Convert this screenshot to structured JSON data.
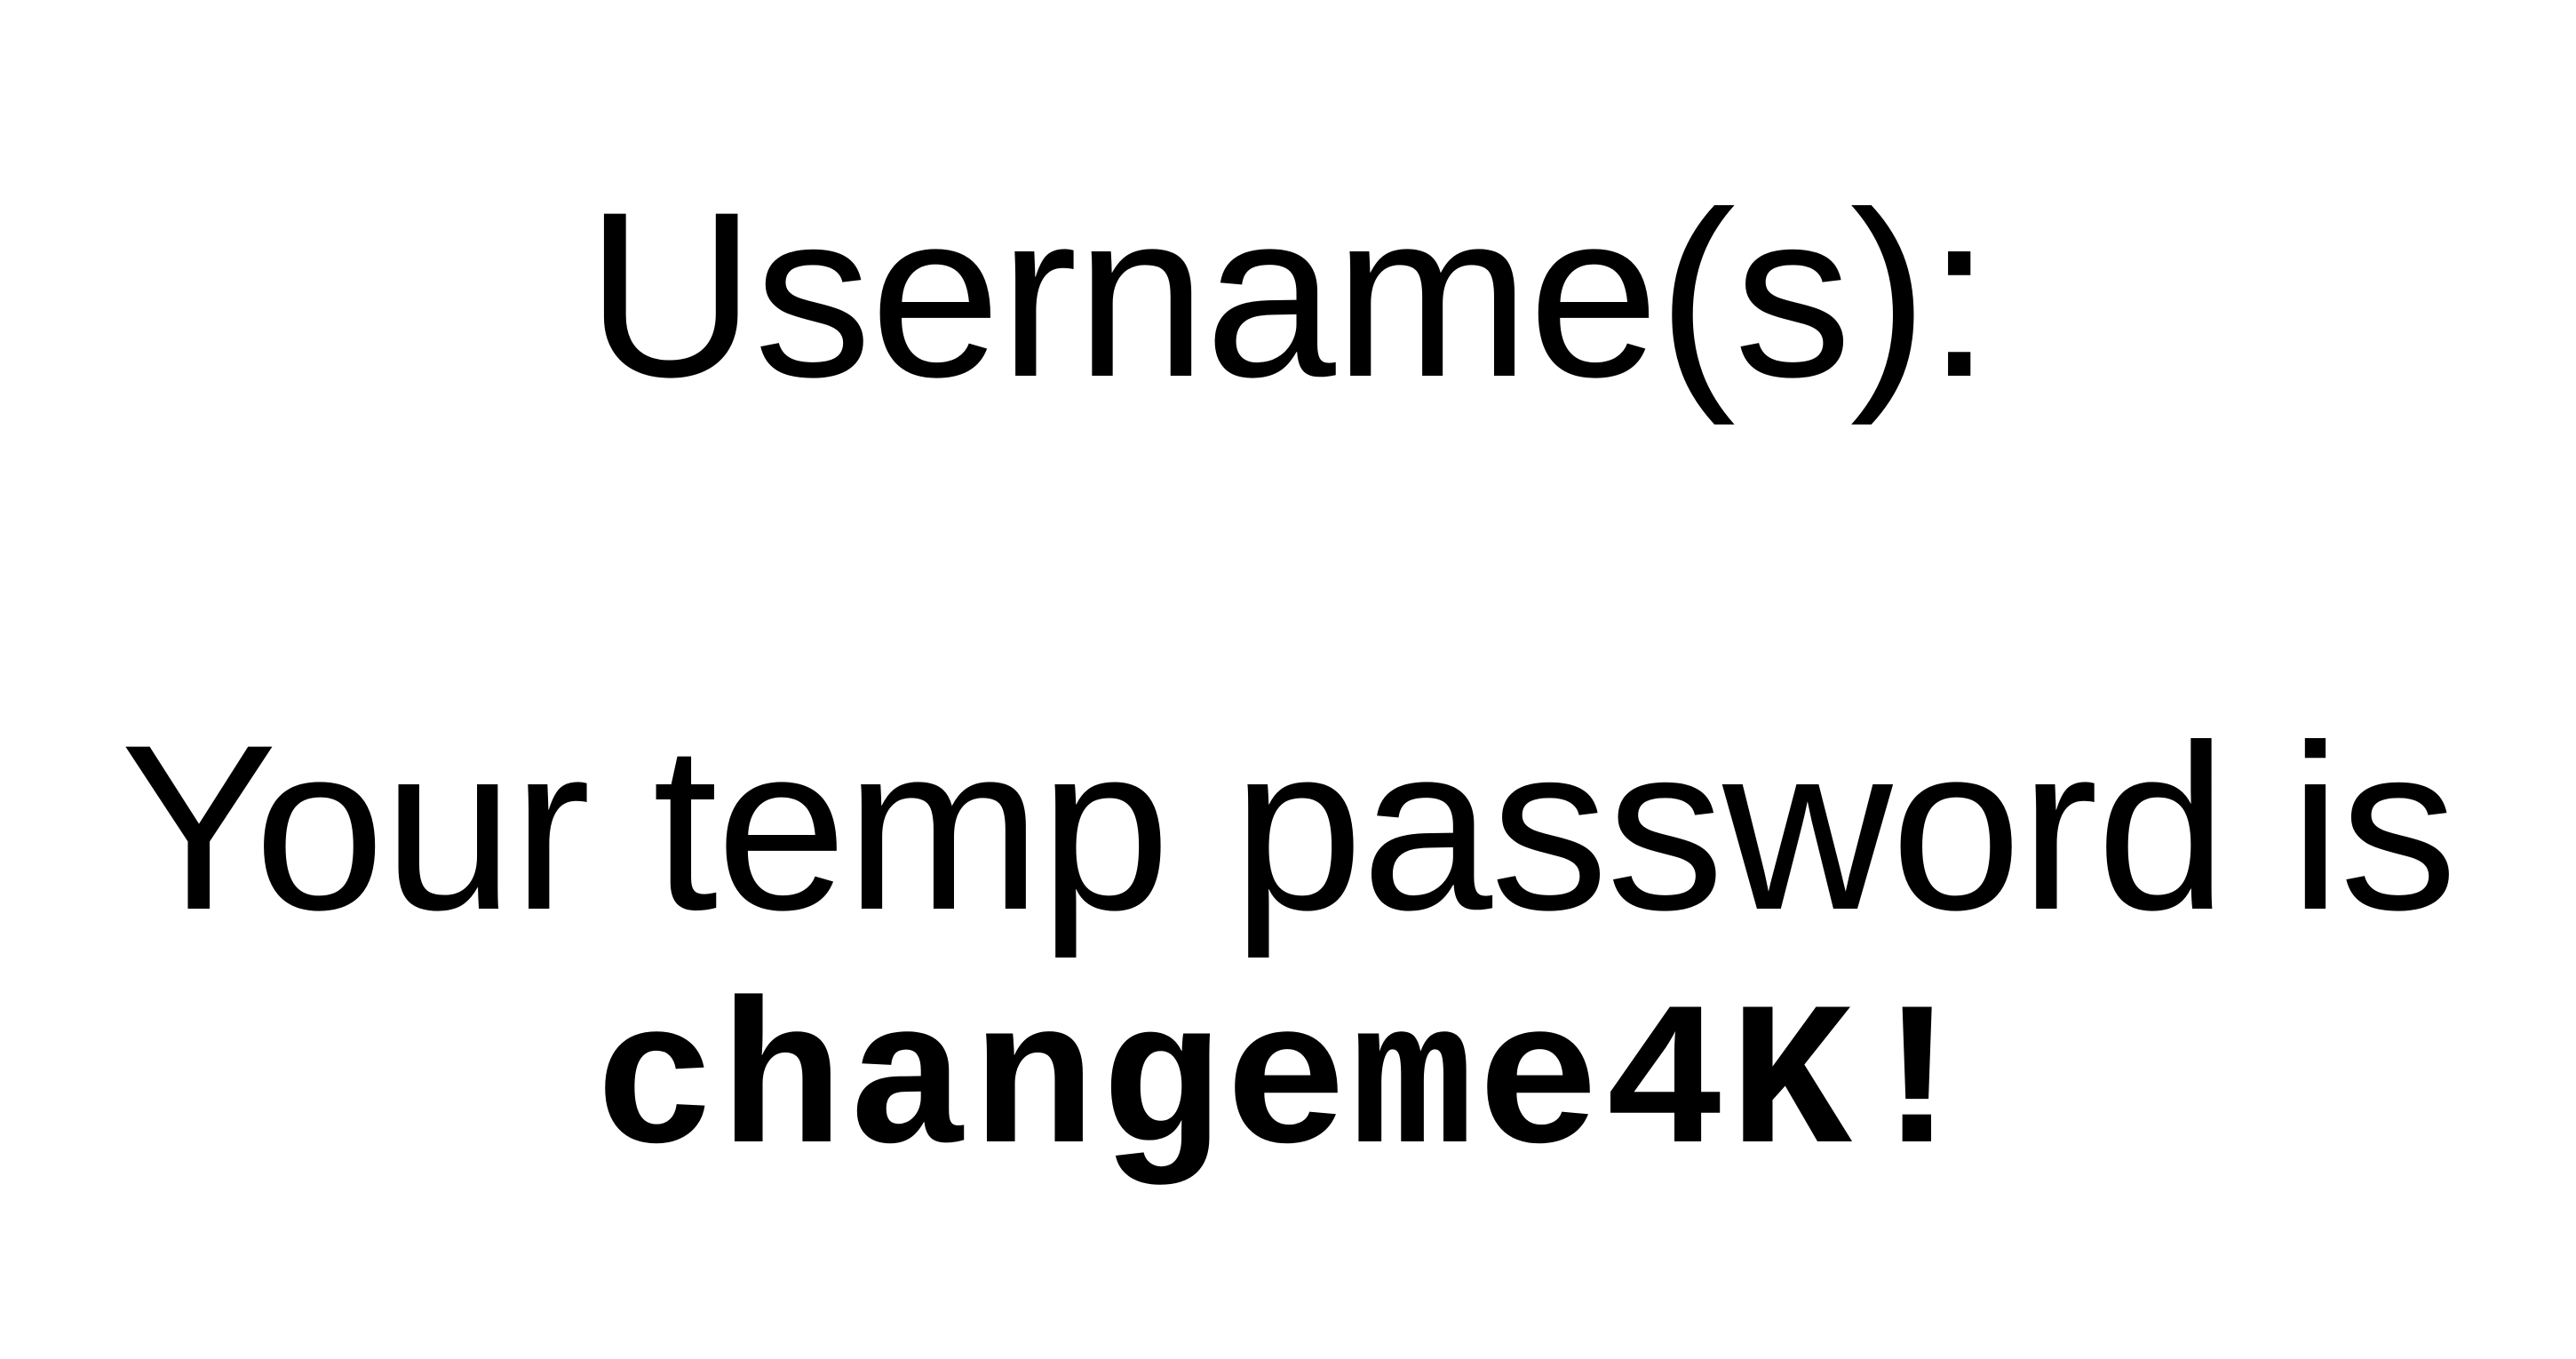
{
  "notice": {
    "username_label": "Username(s):",
    "password_intro": "Your temp password is",
    "password_value": "changeme4K!"
  },
  "colors": {
    "background": "#ffffff",
    "text": "#000000"
  }
}
